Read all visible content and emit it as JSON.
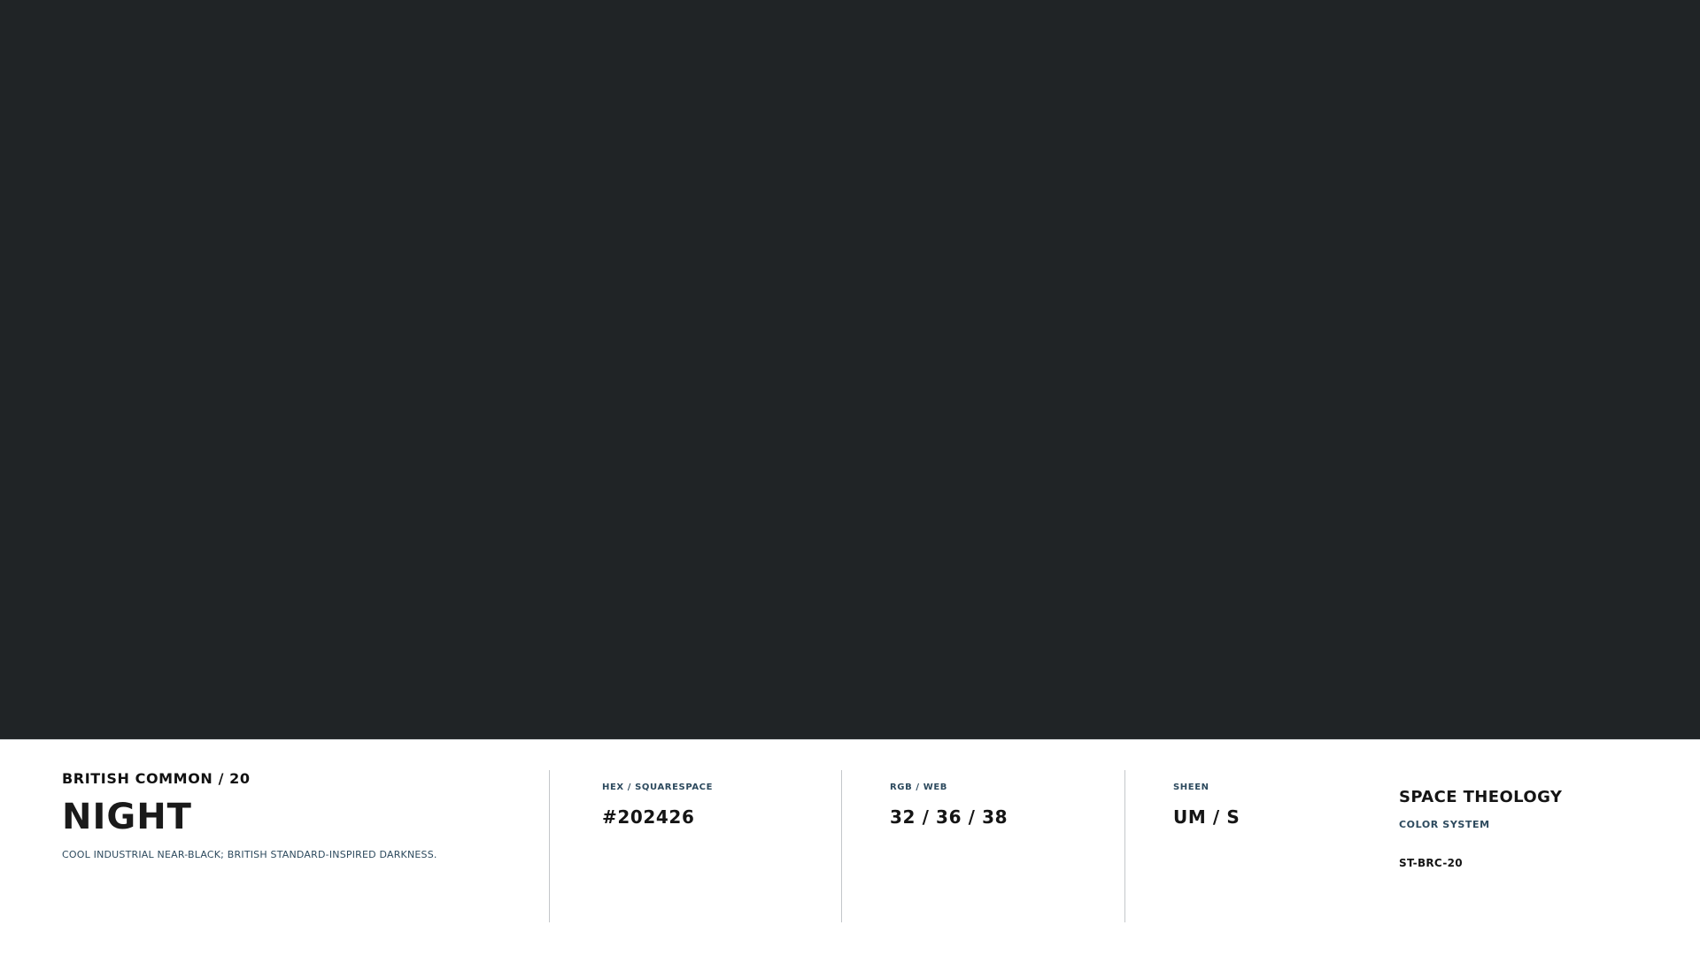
{
  "colors": {
    "swatch": "#202426",
    "accent_text": "#2d4a5e"
  },
  "card": {
    "collection": "BRITISH COMMON / 20",
    "name": "NIGHT",
    "description": "COOL INDUSTRIAL NEAR-BLACK; BRITISH STANDARD-INSPIRED DARKNESS."
  },
  "specs": {
    "hex": {
      "label": "HEX / SQUARESPACE",
      "value": "#202426"
    },
    "rgb": {
      "label": "RGB / WEB",
      "value": "32 / 36 / 38"
    },
    "sheen": {
      "label": "SHEEN",
      "value": "UM / S"
    }
  },
  "brand": {
    "name": "SPACE THEOLOGY",
    "subtitle": "COLOR SYSTEM",
    "code": "ST-BRC-20"
  }
}
